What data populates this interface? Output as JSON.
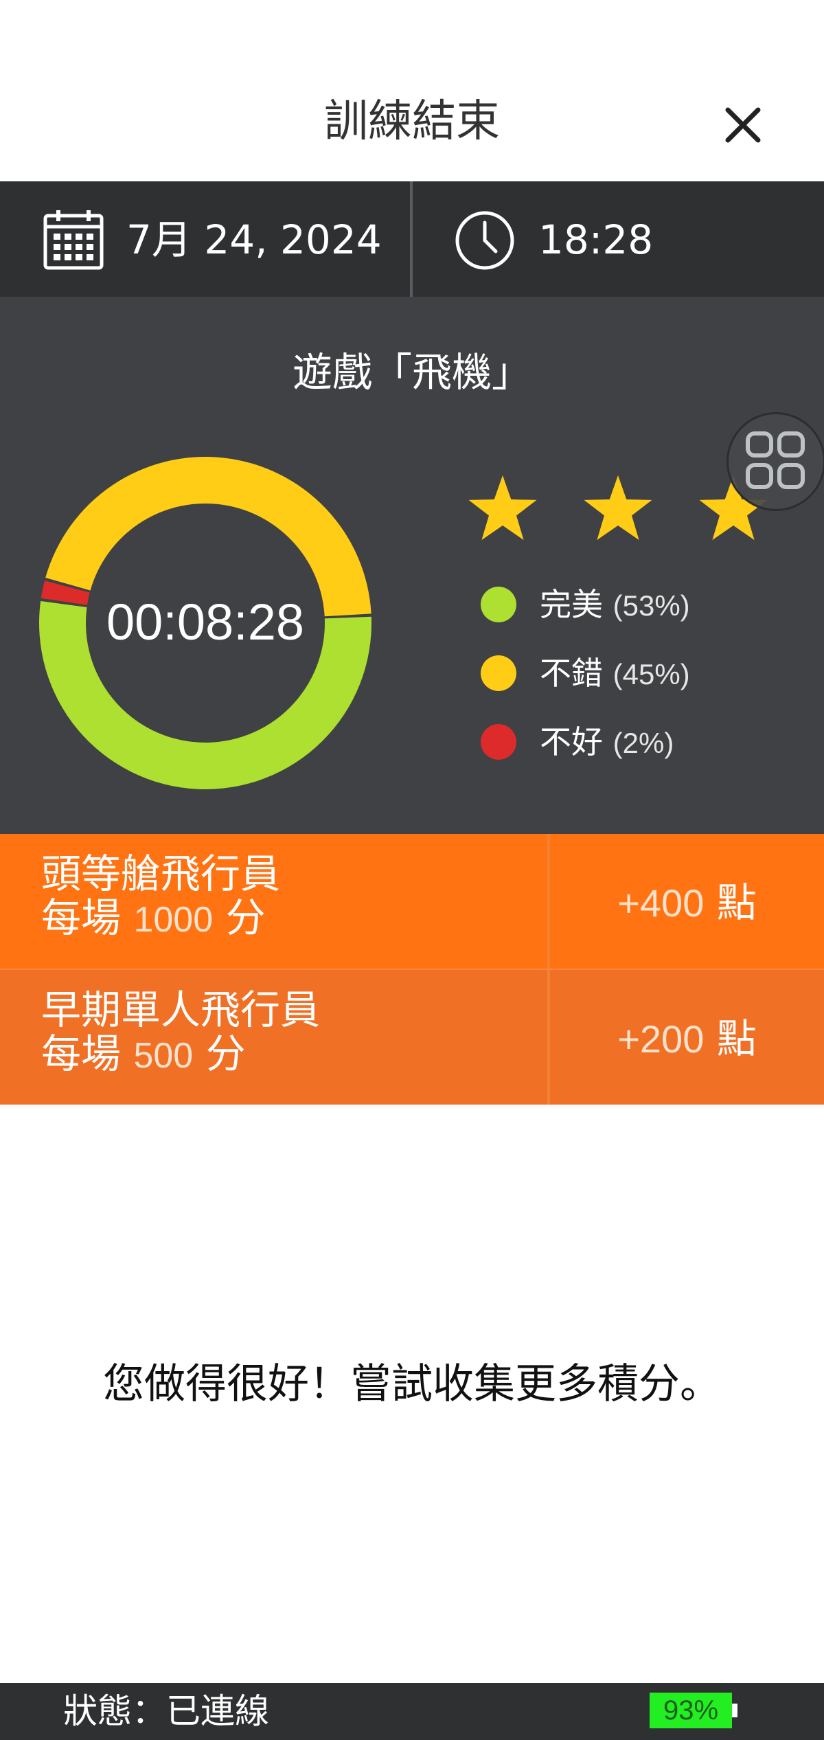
{
  "header": {
    "title": "訓練結束",
    "close_icon": "close-icon"
  },
  "session": {
    "date": "7月 24, 2024",
    "time": "18:28",
    "date_icon": "calendar-icon",
    "time_icon": "clock-icon"
  },
  "results": {
    "game_title": "遊戲「飛機」",
    "duration": "00:08:28",
    "stars_earned": 3,
    "stars_total": 3,
    "star_color": "#ffcc16",
    "breakdown": [
      {
        "label": "完美",
        "percent_text": "(53%)",
        "value": 53,
        "color": "#ade030"
      },
      {
        "label": "不錯",
        "percent_text": "(45%)",
        "value": 45,
        "color": "#ffcc16"
      },
      {
        "label": "不好",
        "percent_text": "(2%)",
        "value": 2,
        "color": "#dd2a2a"
      }
    ],
    "grid_toggle_icon": "grid-icon"
  },
  "achievements": [
    {
      "name": "頭等艙飛行員",
      "per_game_prefix": "每場",
      "per_game_value": "1000",
      "per_game_unit": "分",
      "points_value": "+400",
      "points_unit": "點"
    },
    {
      "name": "早期單人飛行員",
      "per_game_prefix": "每場",
      "per_game_value": "500",
      "per_game_unit": "分",
      "points_value": "+200",
      "points_unit": "點"
    }
  ],
  "message": "您做得很好！嘗試收集更多積分。",
  "status": {
    "label": "狀態：已連線",
    "battery": "93%"
  },
  "colors": {
    "accent_orange": "#ff7313",
    "dark_bar": "#2e3032",
    "panel": "#3f4144",
    "battery_green": "#22ee22"
  }
}
